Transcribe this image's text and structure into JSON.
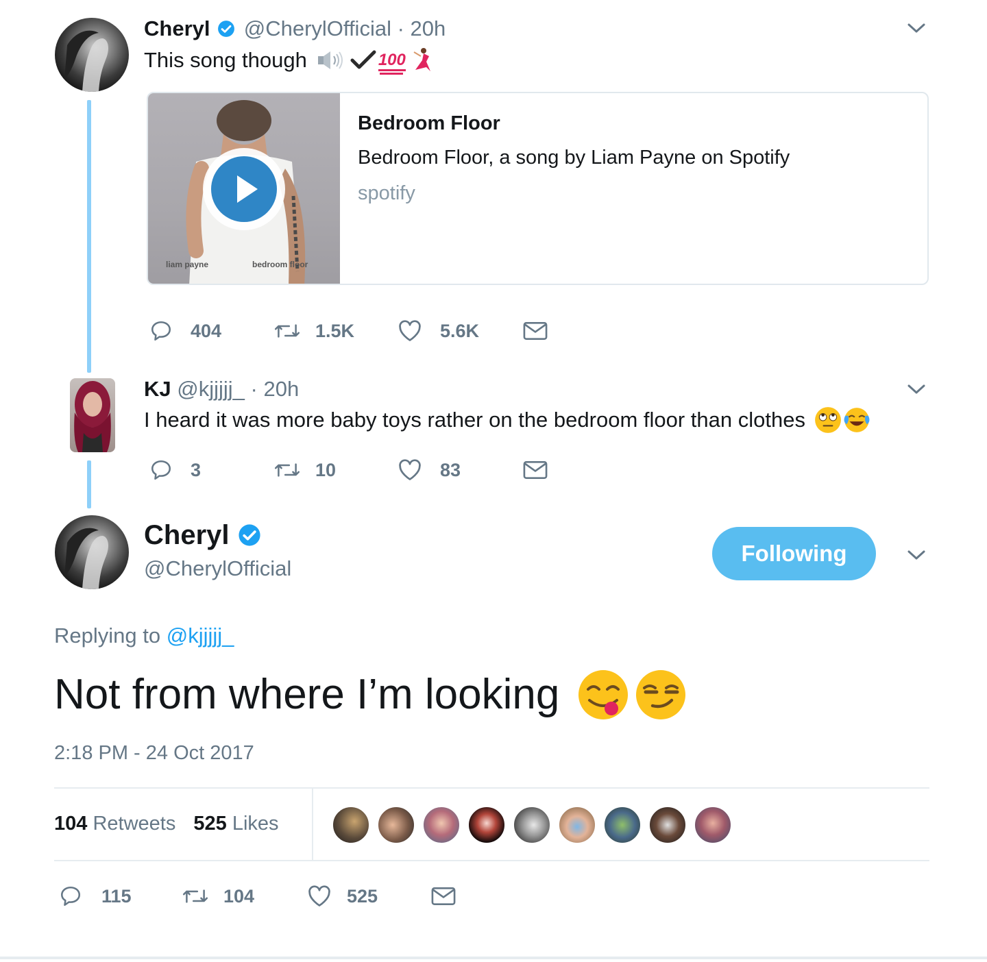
{
  "tweet1": {
    "name": "Cheryl",
    "handle": "@CherylOfficial",
    "time": "· 20h",
    "text": "This song though",
    "emoji_100": "100",
    "card": {
      "title": "Bedroom Floor",
      "description": "Bedroom Floor, a song by Liam Payne on Spotify",
      "domain": "spotify",
      "thumb_artist": "liam payne",
      "thumb_title": "bedroom floor"
    },
    "replies": "404",
    "retweets": "1.5K",
    "likes": "5.6K"
  },
  "tweet2": {
    "name": "KJ",
    "handle": "@kjjjjj_",
    "time": "· 20h",
    "text": "I heard it was more baby toys rather on the bedroom floor than clothes",
    "replies": "3",
    "retweets": "10",
    "likes": "83"
  },
  "main_tweet": {
    "name": "Cheryl",
    "handle": "@CherylOfficial",
    "follow_label": "Following",
    "replying_prefix": "Replying to",
    "replying_handle": "@kjjjjj_",
    "text": "Not from where I’m looking",
    "timestamp": "2:18 PM - 24 Oct 2017",
    "retweets_count": "104",
    "retweets_label": "Retweets",
    "likes_count": "525",
    "likes_label": "Likes",
    "replies": "115",
    "retweets": "104",
    "likes": "525"
  },
  "colors": {
    "accent": "#1da1f2",
    "thread_line": "#8ed0f9",
    "follow_button": "#59bdf0",
    "muted_text": "#657786"
  },
  "icons": [
    "verified-badge-icon",
    "chevron-down-icon",
    "reply-icon",
    "retweet-icon",
    "like-icon",
    "direct-message-icon",
    "play-icon",
    "speaker-icon",
    "check-icon",
    "hundred-points-icon",
    "dancer-icon",
    "face-with-rolling-eyes-icon",
    "face-with-tears-of-joy-icon",
    "face-savoring-food-icon",
    "smirking-face-icon"
  ]
}
